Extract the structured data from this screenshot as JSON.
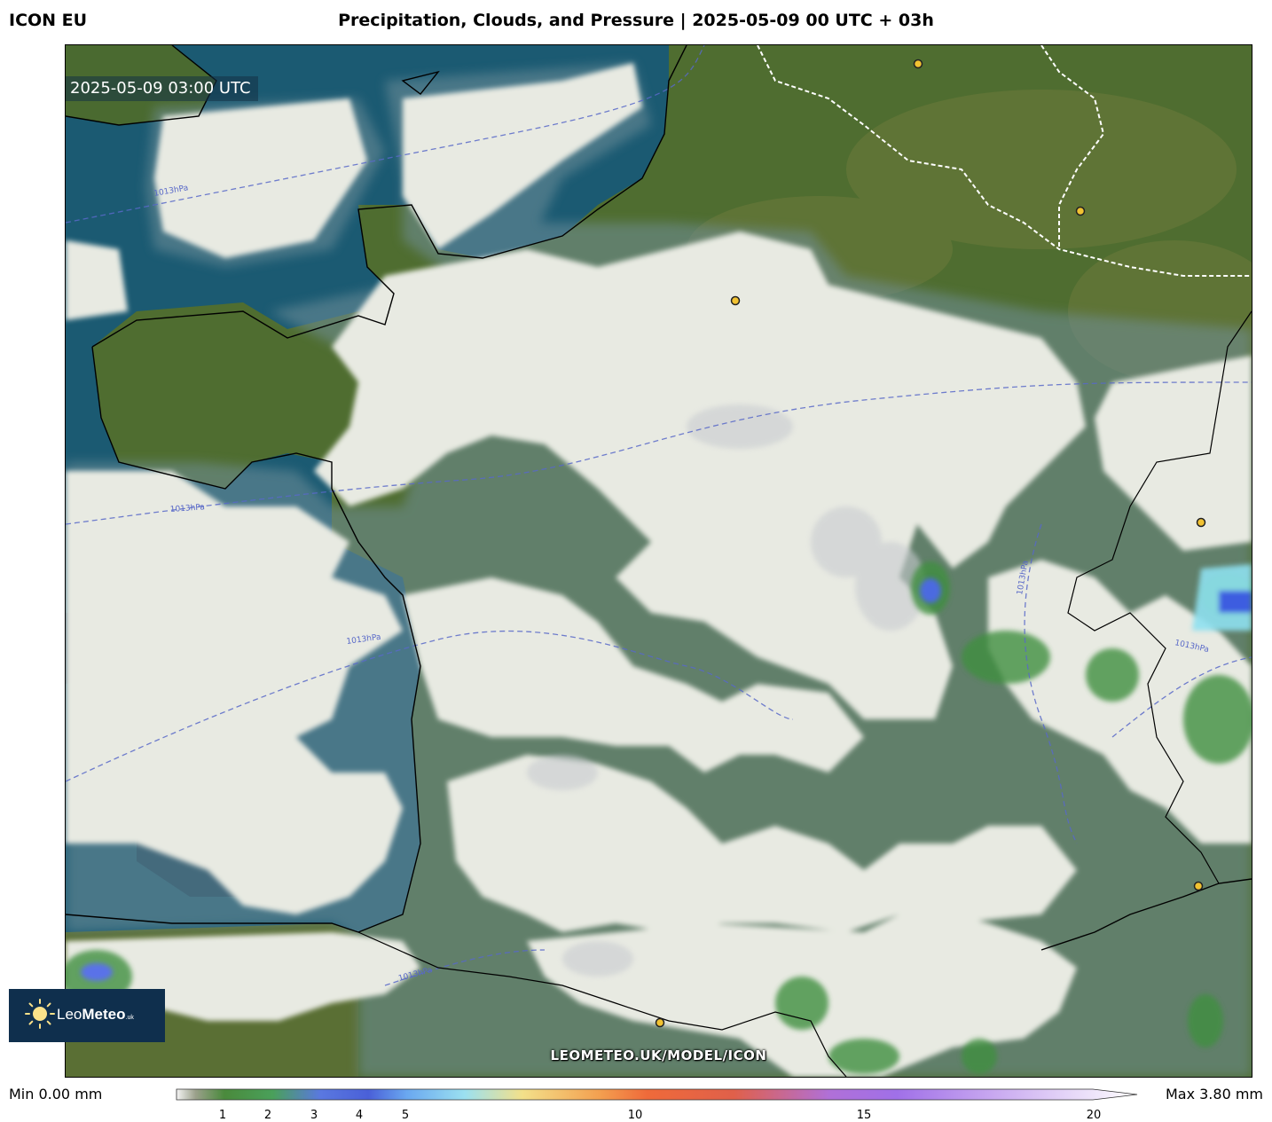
{
  "header": {
    "model": "ICON EU",
    "title": "Precipitation, Clouds, and Pressure | 2025-05-09 00 UTC + 03h"
  },
  "map": {
    "timestamp": "2025-05-09 03:00 UTC",
    "watermark": "LEOMETEO.UK/MODEL/ICON",
    "isobar_label": "1013hPa",
    "colors": {
      "sea": "#1b5a72",
      "land": "#4d6b2e",
      "cloud": "#e9ebe3",
      "precip_light": "#3a8a3a",
      "precip_moderate": "#4b6be0"
    }
  },
  "logo": {
    "brand": "Leo",
    "brand_bold": "Meteo",
    "suffix": ".uk"
  },
  "legend": {
    "min_label": "Min 0.00 mm",
    "max_label": "Max 3.80 mm",
    "ticks": [
      "1",
      "2",
      "3",
      "4",
      "5",
      "10",
      "15",
      "20"
    ]
  }
}
